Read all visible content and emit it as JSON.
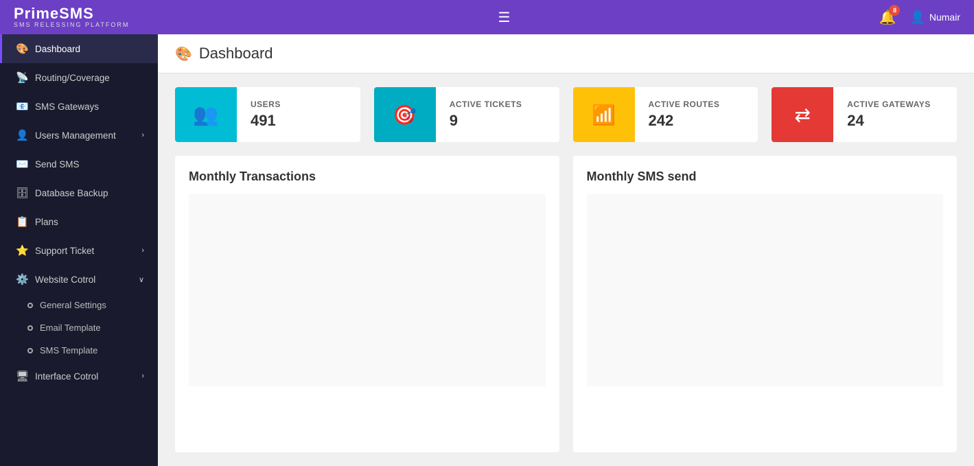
{
  "brand": {
    "title": "PrimeSMS",
    "subtitle": "SMS RELESSING PLATFORM"
  },
  "header": {
    "hamburger_label": "☰",
    "bell_count": "8",
    "user_name": "Numair"
  },
  "page": {
    "title": "Dashboard",
    "icon": "🎨"
  },
  "stats": [
    {
      "id": "users",
      "icon": "👥",
      "color": "teal",
      "label": "USERS",
      "value": "491"
    },
    {
      "id": "active-tickets",
      "icon": "🎯",
      "color": "cyan",
      "label": "ACTIVE TICKETS",
      "value": "9"
    },
    {
      "id": "active-routes",
      "icon": "📶",
      "color": "yellow",
      "label": "ACTIVE ROUTES",
      "value": "242"
    },
    {
      "id": "active-gateways",
      "icon": "⇄",
      "color": "red",
      "label": "ACTIVE GATEWAYS",
      "value": "24"
    }
  ],
  "charts": [
    {
      "id": "monthly-transactions",
      "title": "Monthly Transactions"
    },
    {
      "id": "monthly-sms-send",
      "title": "Monthly SMS send"
    }
  ],
  "sidebar": {
    "items": [
      {
        "id": "dashboard",
        "icon": "🎨",
        "label": "Dashboard",
        "active": true,
        "arrow": ""
      },
      {
        "id": "routing-coverage",
        "icon": "📡",
        "label": "Routing/Coverage",
        "active": false,
        "arrow": ""
      },
      {
        "id": "sms-gateways",
        "icon": "📧",
        "label": "SMS Gateways",
        "active": false,
        "arrow": ""
      },
      {
        "id": "users-management",
        "icon": "👤",
        "label": "Users Management",
        "active": false,
        "arrow": "›"
      },
      {
        "id": "send-sms",
        "icon": "✉️",
        "label": "Send SMS",
        "active": false,
        "arrow": ""
      },
      {
        "id": "database-backup",
        "icon": "🗄",
        "label": "Database Backup",
        "active": false,
        "arrow": ""
      },
      {
        "id": "plans",
        "icon": "📋",
        "label": "Plans",
        "active": false,
        "arrow": ""
      },
      {
        "id": "support-ticket",
        "icon": "⭐",
        "label": "Support Ticket",
        "active": false,
        "arrow": "›"
      },
      {
        "id": "website-control",
        "icon": "⚙️",
        "label": "Website Cotrol",
        "active": false,
        "arrow": "∨"
      }
    ],
    "sub_items": [
      {
        "id": "general-settings",
        "label": "General Settings"
      },
      {
        "id": "email-template",
        "label": "Email Template"
      },
      {
        "id": "sms-template",
        "label": "SMS Template"
      }
    ],
    "interface_item": {
      "id": "interface-control",
      "icon": "🖥",
      "label": "Interface Cotrol",
      "arrow": "›"
    }
  }
}
